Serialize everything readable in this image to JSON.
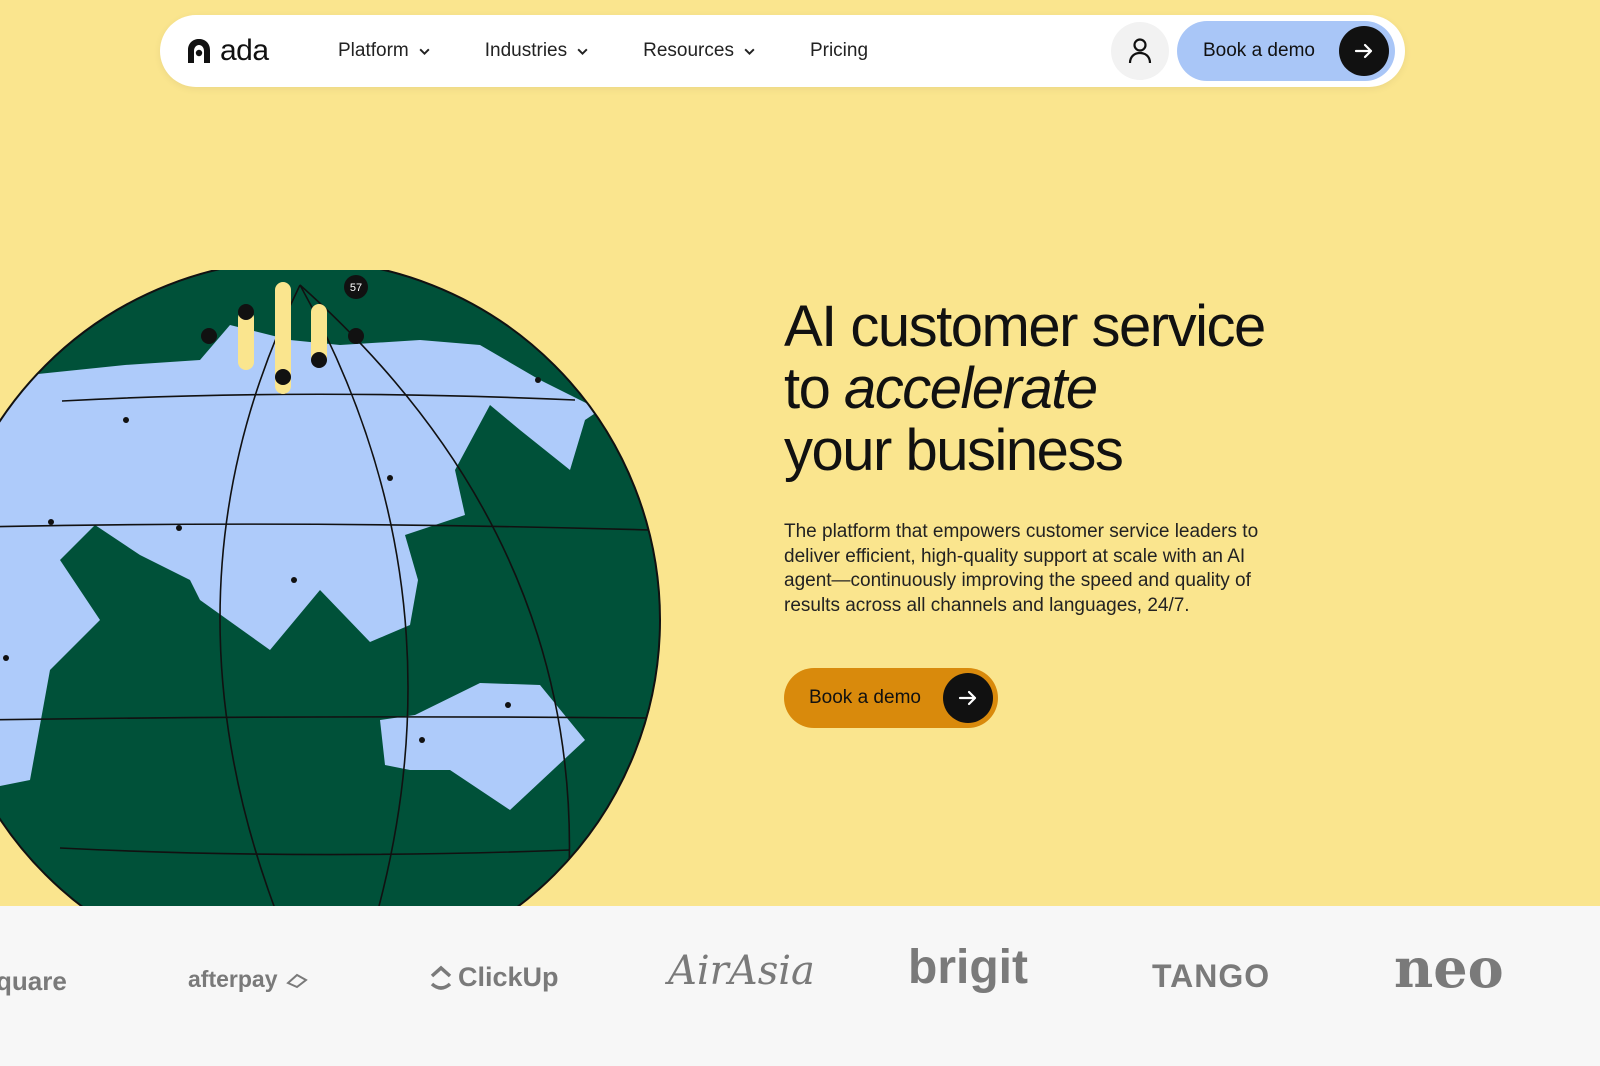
{
  "nav": {
    "logo_text": "ada",
    "menu": [
      {
        "label": "Platform",
        "has_dropdown": true
      },
      {
        "label": "Industries",
        "has_dropdown": true
      },
      {
        "label": "Resources",
        "has_dropdown": true
      },
      {
        "label": "Pricing",
        "has_dropdown": false
      }
    ],
    "user_icon": "user-icon",
    "demo_label": "Book a demo"
  },
  "hero": {
    "headline_line1": "AI customer service",
    "headline_line2_prefix": "to ",
    "headline_line2_em": "accelerate",
    "headline_line3": "your business",
    "subtext": "The platform that empowers customer service leaders to deliver efficient, high-quality support at scale with an AI agent—continuously improving the speed and quality of results across all channels and languages, 24/7.",
    "cta_label": "Book a demo",
    "globe_badge": "57"
  },
  "logos": {
    "square": "quare",
    "afterpay": "afterpay",
    "clickup": "ClickUp",
    "airasia": "AirAsia",
    "brigit": "brigit",
    "tango": "TANGO",
    "neo": "neo"
  },
  "colors": {
    "background": "#fae58e",
    "globe_ocean": "#005139",
    "globe_land": "#aecbfa",
    "cta_orange": "#d98a0c",
    "nav_demo_blue": "#a9c6f7"
  }
}
